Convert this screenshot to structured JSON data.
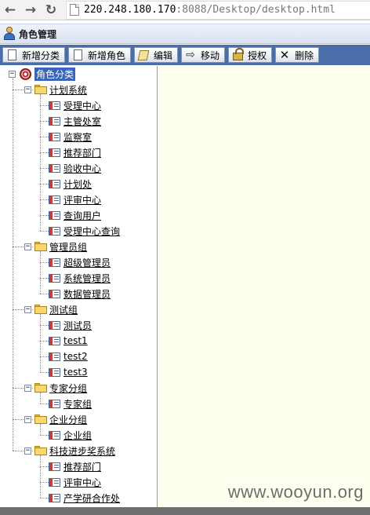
{
  "browser": {
    "url_host": "220.248.180.170",
    "url_rest": ":8088/Desktop/desktop.html"
  },
  "title": "角色管理",
  "toolbar": {
    "add_category": "新增分类",
    "add_role": "新增角色",
    "edit": "编辑",
    "move": "移动",
    "authorize": "授权",
    "delete": "删除"
  },
  "tree": {
    "root": "角色分类",
    "groups": [
      {
        "name": "计划系统",
        "children": [
          "受理中心",
          "主管处室",
          "监察室",
          "推荐部门",
          "验收中心",
          "计划处",
          "评审中心",
          "查询用户",
          "受理中心查询"
        ]
      },
      {
        "name": "管理员组",
        "children": [
          "超级管理员",
          "系统管理员",
          "数据管理员"
        ]
      },
      {
        "name": "测试组",
        "children": [
          "测试员",
          "test1",
          "test2",
          "test3"
        ]
      },
      {
        "name": "专家分组",
        "children": [
          "专家组"
        ]
      },
      {
        "name": "企业分组",
        "children": [
          "企业组"
        ]
      },
      {
        "name": "科技进步奖系统",
        "children": [
          "推荐部门",
          "评审中心",
          "产学研合作处"
        ]
      }
    ]
  },
  "watermark": "www.wooyun.org"
}
